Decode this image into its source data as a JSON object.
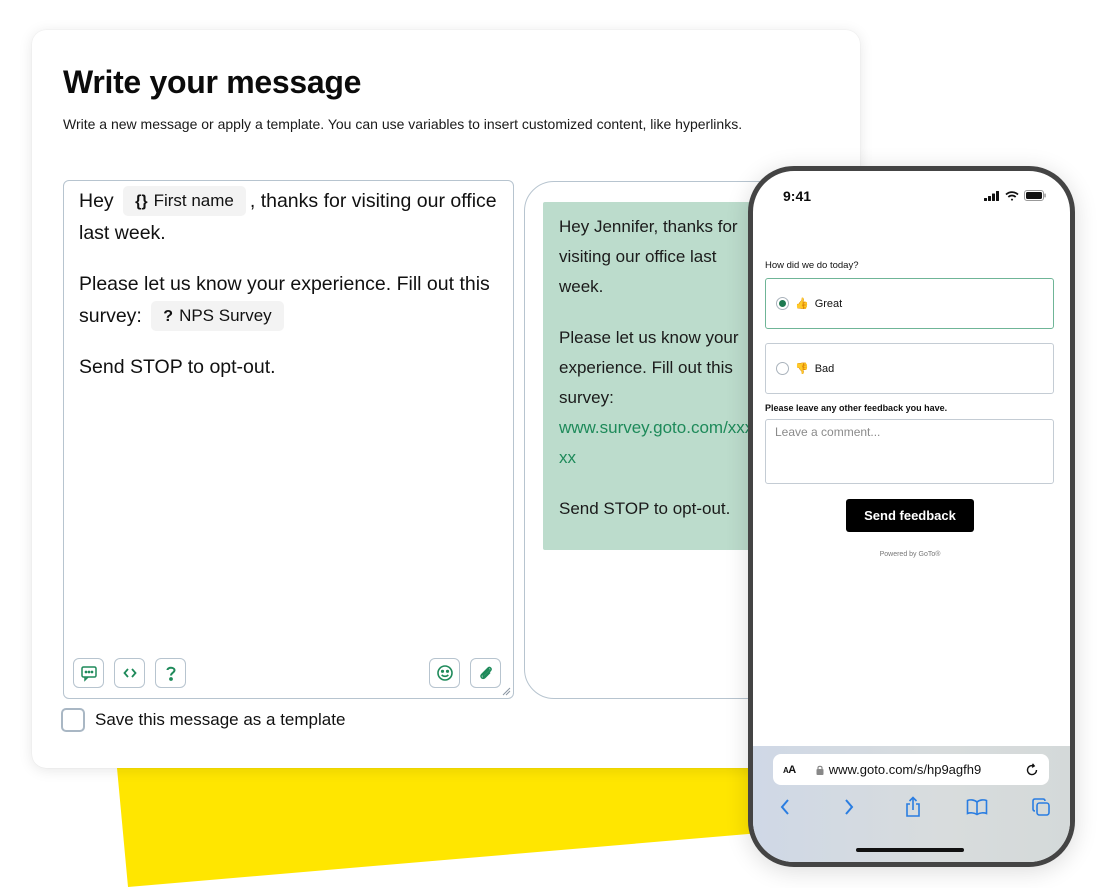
{
  "composer": {
    "title": "Write your message",
    "description": "Write a new message or apply a template. You can use variables to insert customized content, like hyperlinks.",
    "editor": {
      "line1_before": "Hey",
      "variable_chip": {
        "glyph": "{}",
        "label": "First name"
      },
      "line1_after": ", thanks for visiting our office last week.",
      "line2_before": "Please let us know your experience. Fill out this survey:",
      "survey_chip": {
        "glyph": "?",
        "label": "NPS Survey"
      },
      "line3": "Send STOP to opt-out.",
      "toolbar_left": [
        "message-template-icon",
        "code-variable-icon",
        "survey-question-icon"
      ],
      "toolbar_right": [
        "emoji-icon",
        "attachment-icon"
      ]
    },
    "save_template": {
      "label": "Save this message as a template",
      "checked": false
    },
    "preview": {
      "paragraph1": "Hey Jennifer, thanks for visiting our office last week.",
      "paragraph2": "Please let us know your experience. Fill out this survey:",
      "link": "www.survey.goto.com/xxxxx",
      "paragraph3": "Send STOP to opt-out."
    }
  },
  "phone": {
    "status_time": "9:41",
    "survey": {
      "question": "How did we do today?",
      "options": [
        {
          "emoji": "👍",
          "label": "Great",
          "selected": true
        },
        {
          "emoji": "👎",
          "label": "Bad",
          "selected": false
        }
      ],
      "feedback_label": "Please leave any other feedback you have.",
      "comment_placeholder": "Leave a comment...",
      "submit_label": "Send feedback",
      "powered_by": "Powered by GoTo®"
    },
    "browser": {
      "text_size_label": "AA",
      "url": "www.goto.com/s/hp9agfh9"
    }
  },
  "colors": {
    "accent_green": "#1e8a5a",
    "preview_bubble": "#bcdccc",
    "yellow_decoration": "#ffe600",
    "ios_blue": "#2a7de1"
  }
}
